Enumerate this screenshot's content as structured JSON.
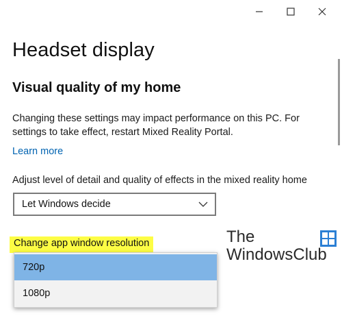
{
  "window": {
    "controls": {
      "minimize_icon": "minimize-icon",
      "maximize_icon": "maximize-icon",
      "close_icon": "close-icon"
    }
  },
  "page": {
    "title": "Headset display",
    "section_title": "Visual quality of my home",
    "description": "Changing these settings may impact performance on this PC. For settings to take effect, restart Mixed Reality Portal.",
    "learn_more": "Learn more",
    "adjust_label": "Adjust level of detail and quality of effects in the mixed reality home",
    "quality_dropdown": {
      "value": "Let Windows decide"
    },
    "resolution_label": "Change app window resolution",
    "resolution_options": [
      "720p",
      "1080p"
    ],
    "resolution_selected": "720p"
  },
  "watermark": {
    "line1": "The",
    "line2": "WindowsClub"
  },
  "colors": {
    "accent": "#0063b1",
    "highlight": "#fdfd44",
    "selected_option": "#7fb4e6",
    "logo_blue": "#2b7fd4"
  }
}
